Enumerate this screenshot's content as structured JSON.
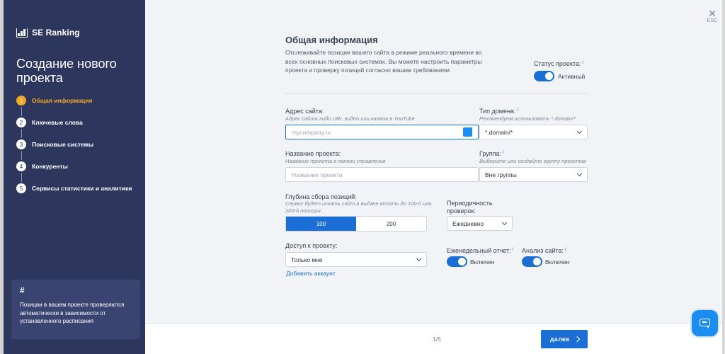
{
  "sidebar": {
    "logo_text": "SE Ranking",
    "title": "Создание нового проекта",
    "steps": [
      {
        "num": "1",
        "label": "Общая информация"
      },
      {
        "num": "2",
        "label": "Ключевые слова"
      },
      {
        "num": "3",
        "label": "Поисковые системы"
      },
      {
        "num": "4",
        "label": "Конкуренты"
      },
      {
        "num": "5",
        "label": "Сервисы статистики и аналитики"
      }
    ],
    "active_step": 1,
    "info_card": {
      "symbol": "#",
      "text": "Позиции в вашем проекте проверяются автоматически в зависимости от установленного расписания"
    }
  },
  "close": {
    "esc_label": "ESC"
  },
  "general": {
    "title": "Общая информация",
    "description": "Отслеживайте позиции вашего сайта в режиме реального времени во всех основных поисковых системах. Вы можете настроить параметры проекта и проверку позиций согласно вашим требованиям"
  },
  "status": {
    "label": "Статус проекта:",
    "value": "Активный"
  },
  "site": {
    "label": "Адрес сайта:",
    "hint": "Адрес сайта либо URL видео или канала в YouTube",
    "placeholder": "mycompany.ru"
  },
  "domain_type": {
    "label": "Тип домена:",
    "hint": "Рекомендуем использовать *.domain/*",
    "value": "*.domain/*"
  },
  "project_name": {
    "label": "Название проекта:",
    "hint": "Название проекта в панели управления",
    "placeholder": "Название проекта"
  },
  "group": {
    "label": "Группа:",
    "hint": "Выберите или создайте группу проектов",
    "value": "Вне группы"
  },
  "depth": {
    "label": "Глубина сбора позиций:",
    "hint": "Сервис будет искать сайт в выдаче вплоть до 100-й или 200-й позиции",
    "options": [
      "100",
      "200"
    ],
    "selected": "100"
  },
  "frequency": {
    "label": "Периодичность проверок:",
    "value": "Ежедневно"
  },
  "access": {
    "label": "Доступ к проекту:",
    "value": "Только мне",
    "add_link": "Добавить аккаунт"
  },
  "weekly_report": {
    "label": "Еженедельный отчет:",
    "value": "Включен"
  },
  "site_audit": {
    "label": "Анализ сайта:",
    "value": "Включен"
  },
  "footer": {
    "pager": "1/5",
    "next_label": "ДАЛЕЕ"
  },
  "info_marker": "i"
}
